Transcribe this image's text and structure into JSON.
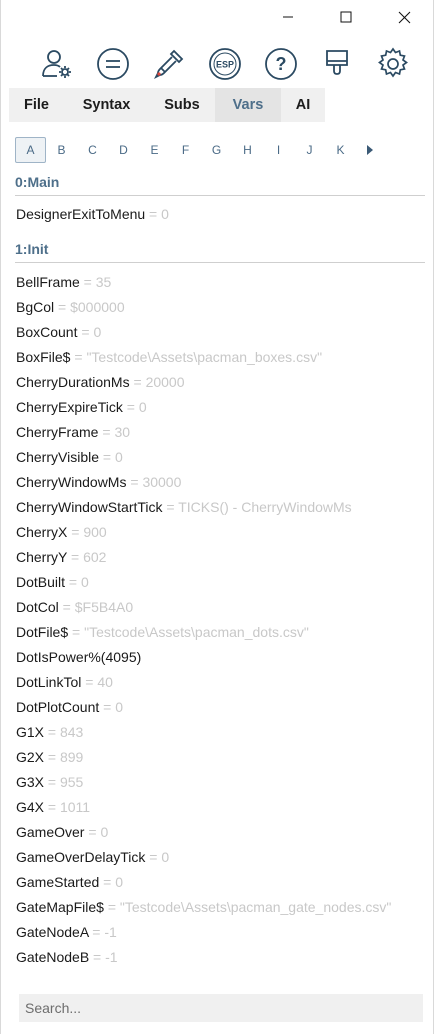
{
  "window_controls": {
    "minimize": "minimize-icon",
    "maximize": "maximize-icon",
    "close": "close-icon"
  },
  "toolbar": {
    "icons": [
      "user-settings-icon",
      "list-menu-icon",
      "eyedropper-icon",
      "esp-icon",
      "help-icon",
      "brush-icon",
      "gear-icon"
    ],
    "esp_label": "ESP",
    "help_label": "?"
  },
  "menu": {
    "tabs": [
      "File",
      "Syntax",
      "Subs",
      "Vars",
      "AI"
    ],
    "active": "Vars"
  },
  "letters": {
    "items": [
      "A",
      "B",
      "C",
      "D",
      "E",
      "F",
      "G",
      "H",
      "I",
      "J",
      "K"
    ],
    "active": "A",
    "next": "▶"
  },
  "sections": [
    {
      "title": "0:Main",
      "vars": [
        {
          "name": "DesignerExitToMenu",
          "value": "0"
        }
      ]
    },
    {
      "title": "1:Init",
      "vars": [
        {
          "name": "BellFrame",
          "value": "35"
        },
        {
          "name": "BgCol",
          "value": "$000000"
        },
        {
          "name": "BoxCount",
          "value": "0"
        },
        {
          "name": "BoxFile$",
          "value": "\"Testcode\\Assets\\pacman_boxes.csv\""
        },
        {
          "name": "CherryDurationMs",
          "value": "20000"
        },
        {
          "name": "CherryExpireTick",
          "value": "0"
        },
        {
          "name": "CherryFrame",
          "value": "30"
        },
        {
          "name": "CherryVisible",
          "value": "0"
        },
        {
          "name": "CherryWindowMs",
          "value": "30000"
        },
        {
          "name": "CherryWindowStartTick",
          "value": "TICKS() - CherryWindowMs"
        },
        {
          "name": "CherryX",
          "value": "900"
        },
        {
          "name": "CherryY",
          "value": "602"
        },
        {
          "name": "DotBuilt",
          "value": "0"
        },
        {
          "name": "DotCol",
          "value": "$F5B4A0"
        },
        {
          "name": "DotFile$",
          "value": "\"Testcode\\Assets\\pacman_dots.csv\""
        },
        {
          "name": "DotIsPower%(4095)",
          "value": null
        },
        {
          "name": "DotLinkTol",
          "value": "40"
        },
        {
          "name": "DotPlotCount",
          "value": "0"
        },
        {
          "name": "G1X",
          "value": "843"
        },
        {
          "name": "G2X",
          "value": "899"
        },
        {
          "name": "G3X",
          "value": "955"
        },
        {
          "name": "G4X",
          "value": "1011"
        },
        {
          "name": "GameOver",
          "value": "0"
        },
        {
          "name": "GameOverDelayTick",
          "value": "0"
        },
        {
          "name": "GameStarted",
          "value": "0"
        },
        {
          "name": "GateMapFile$",
          "value": "\"Testcode\\Assets\\pacman_gate_nodes.csv\""
        },
        {
          "name": "GateNodeA",
          "value": "-1"
        },
        {
          "name": "GateNodeB",
          "value": "-1"
        }
      ]
    }
  ],
  "search": {
    "placeholder": "Search..."
  }
}
